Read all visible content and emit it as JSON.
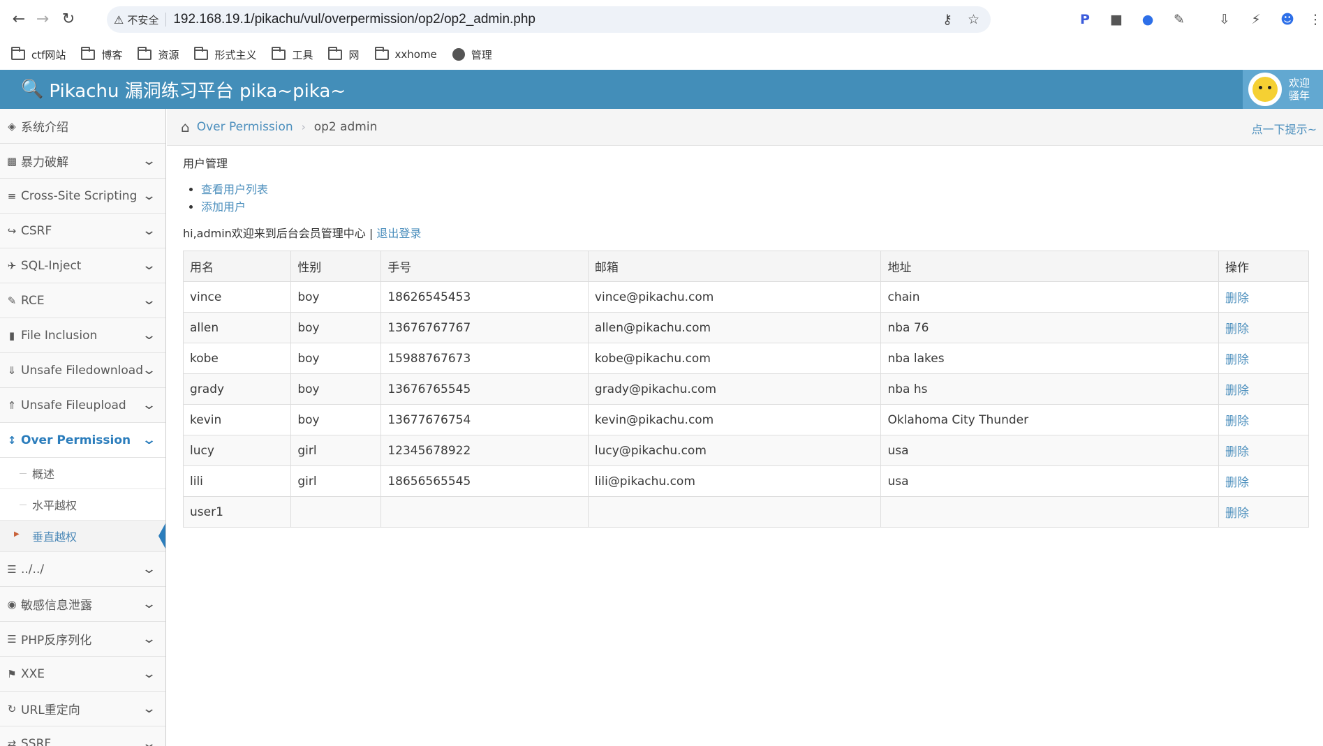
{
  "browser": {
    "security_label": "不安全",
    "url": "192.168.19.1/pikachu/vul/overpermission/op2/op2_admin.php",
    "bookmarks": [
      "ctf网站",
      "博客",
      "资源",
      "形式主义",
      "工具",
      "网",
      "xxhome",
      "管理"
    ]
  },
  "header": {
    "title": "Pikachu 漏洞练习平台 pika~pika~",
    "welcome_line1": "欢迎",
    "welcome_line2": "骚年"
  },
  "sidebar": {
    "items": [
      {
        "label": "系统介绍",
        "icon": "tags-icon"
      },
      {
        "label": "暴力破解",
        "icon": "lock-icon"
      },
      {
        "label": "Cross-Site Scripting",
        "icon": "tree-icon"
      },
      {
        "label": "CSRF",
        "icon": "share-icon"
      },
      {
        "label": "SQL-Inject",
        "icon": "plane-icon"
      },
      {
        "label": "RCE",
        "icon": "pencil-icon"
      },
      {
        "label": "File Inclusion",
        "icon": "file-icon"
      },
      {
        "label": "Unsafe Filedownload",
        "icon": "download-icon"
      },
      {
        "label": "Unsafe Fileupload",
        "icon": "upload-icon"
      },
      {
        "label": "Over Permission",
        "icon": "text-height-icon"
      },
      {
        "label": "../../",
        "icon": "list-icon"
      },
      {
        "label": "敏感信息泄露",
        "icon": "camera-icon"
      },
      {
        "label": "PHP反序列化",
        "icon": "list-icon"
      },
      {
        "label": "XXE",
        "icon": "flag-icon"
      },
      {
        "label": "URL重定向",
        "icon": "refresh-icon"
      },
      {
        "label": "SSRF",
        "icon": "exchange-icon"
      }
    ],
    "sub_items": [
      "概述",
      "水平越权",
      "垂直越权"
    ]
  },
  "breadcrumb": {
    "section": "Over Permission",
    "page": "op2 admin",
    "hint": "点一下提示~"
  },
  "main": {
    "section_title": "用户管理",
    "links": [
      "查看用户列表",
      "添加用户"
    ],
    "welcome_text": "hi,admin欢迎来到后台会员管理中心 | ",
    "logout": "退出登录",
    "table": {
      "headers": [
        "用名",
        "性别",
        "手号",
        "邮箱",
        "地址",
        "操作"
      ],
      "rows": [
        [
          "vince",
          "boy",
          "18626545453",
          "vince@pikachu.com",
          "chain",
          "删除"
        ],
        [
          "allen",
          "boy",
          "13676767767",
          "allen@pikachu.com",
          "nba 76",
          "删除"
        ],
        [
          "kobe",
          "boy",
          "15988767673",
          "kobe@pikachu.com",
          "nba lakes",
          "删除"
        ],
        [
          "grady",
          "boy",
          "13676765545",
          "grady@pikachu.com",
          "nba hs",
          "删除"
        ],
        [
          "kevin",
          "boy",
          "13677676754",
          "kevin@pikachu.com",
          "Oklahoma City Thunder",
          "删除"
        ],
        [
          "lucy",
          "girl",
          "12345678922",
          "lucy@pikachu.com",
          "usa",
          "删除"
        ],
        [
          "lili",
          "girl",
          "18656565545",
          "lili@pikachu.com",
          "usa",
          "删除"
        ],
        [
          "user1",
          "",
          "",
          "",
          "",
          "删除"
        ]
      ]
    }
  },
  "colors": {
    "header_bg": "#438eb9",
    "link": "#4c8fbd",
    "active": "#2b7dbc"
  }
}
